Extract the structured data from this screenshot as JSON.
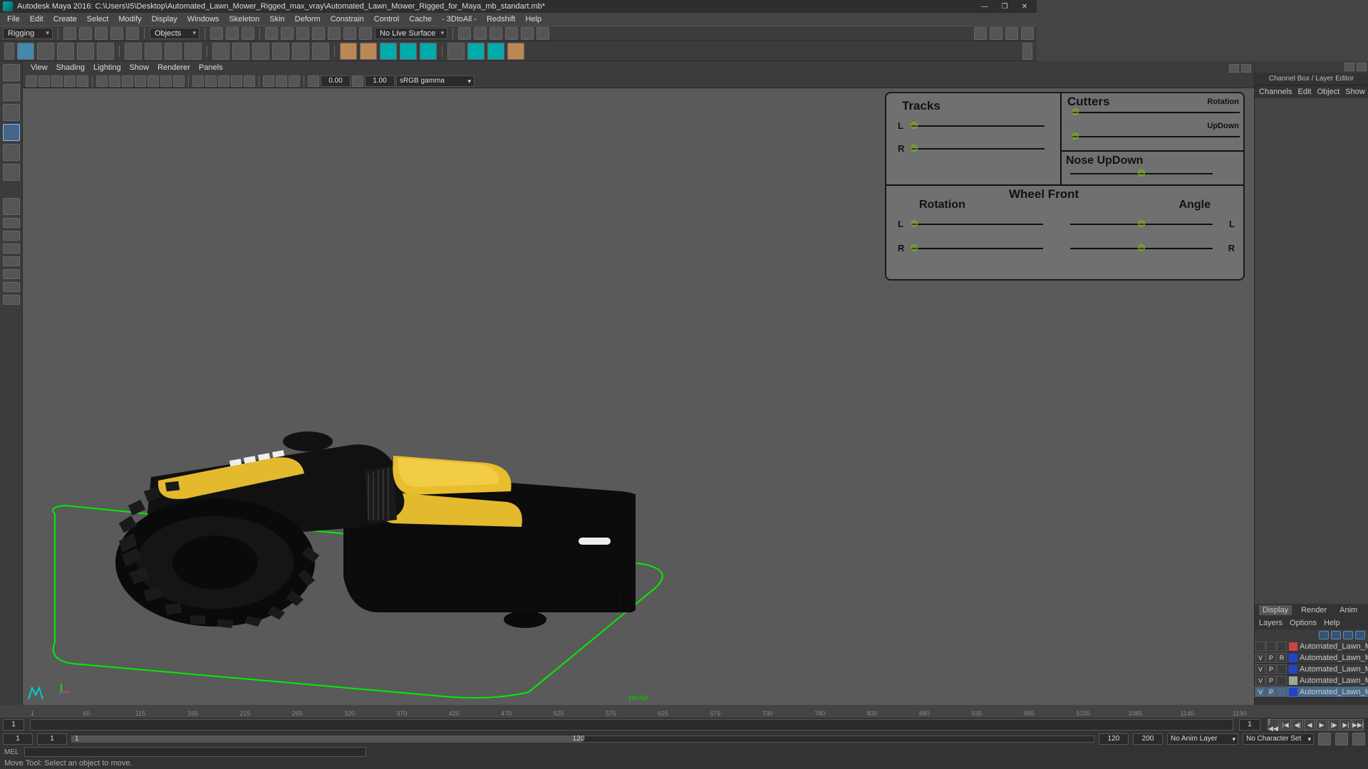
{
  "titlebar": {
    "app": "Autodesk Maya 2016:",
    "path": "C:\\Users\\I5\\Desktop\\Automated_Lawn_Mower_Rigged_max_vray\\Automated_Lawn_Mower_Rigged_for_Maya_mb_standart.mb*"
  },
  "main_menu": [
    "File",
    "Edit",
    "Create",
    "Select",
    "Modify",
    "Display",
    "Windows",
    "Skeleton",
    "Skin",
    "Deform",
    "Constrain",
    "Control",
    "Cache",
    "- 3DtoAll -",
    "Redshift",
    "Help"
  ],
  "shelf": {
    "mode": "Rigging",
    "mask_dd": "Objects",
    "surface_dd": "No Live Surface"
  },
  "vp_menu": [
    "View",
    "Shading",
    "Lighting",
    "Show",
    "Renderer",
    "Panels"
  ],
  "vp_toolbar": {
    "field1": "0.00",
    "field2": "1.00",
    "space": "sRGB gamma"
  },
  "camera": "persp",
  "rig": {
    "tracks_h": "Tracks",
    "L": "L",
    "R": "R",
    "cutters_h": "Cutters",
    "rotation_s": "Rotation",
    "updown_s": "UpDown",
    "nose_h": "Nose UpDown",
    "wheel_h": "Wheel Front",
    "rotation_h": "Rotation",
    "angle_h": "Angle"
  },
  "right_panel": {
    "header": "Channel Box / Layer Editor",
    "tabs": [
      "Channels",
      "Edit",
      "Object",
      "Show"
    ],
    "tabs2": [
      "Display",
      "Render",
      "Anim"
    ],
    "row2": [
      "Layers",
      "Options",
      "Help"
    ],
    "layers": [
      {
        "v": "",
        "p": "",
        "r": "",
        "color": "#c44",
        "name": "Automated_Lawn_Mo..."
      },
      {
        "v": "V",
        "p": "P",
        "r": "R",
        "color": "#24c",
        "name": "Automated_Lawn_Mower"
      },
      {
        "v": "V",
        "p": "P",
        "r": "",
        "color": "#24c",
        "name": "Automated_Lawn_Mo..."
      },
      {
        "v": "V",
        "p": "P",
        "r": "",
        "color": "#9a9",
        "name": "Automated_Lawn_Mo..."
      },
      {
        "v": "V",
        "p": "P",
        "r": "",
        "color": "#24c",
        "name": "Automated_Lawn_Mo...",
        "sel": true
      }
    ]
  },
  "timeline": {
    "start": "1",
    "ticks": [
      "1",
      "60",
      "115",
      "165",
      "215",
      "265",
      "320",
      "370",
      "420",
      "470",
      "525",
      "575",
      "625",
      "675",
      "730",
      "780",
      "830",
      "880",
      "935",
      "985",
      "1035",
      "1085",
      "1140",
      "1190"
    ],
    "end": "1"
  },
  "range": {
    "a": "1",
    "b": "1",
    "c": "1",
    "d": "120",
    "e": "120",
    "f": "200",
    "anim_layer": "No Anim Layer",
    "char_set": "No Character Set"
  },
  "cmd": {
    "lang": "MEL"
  },
  "help": "Move Tool: Select an object to move."
}
